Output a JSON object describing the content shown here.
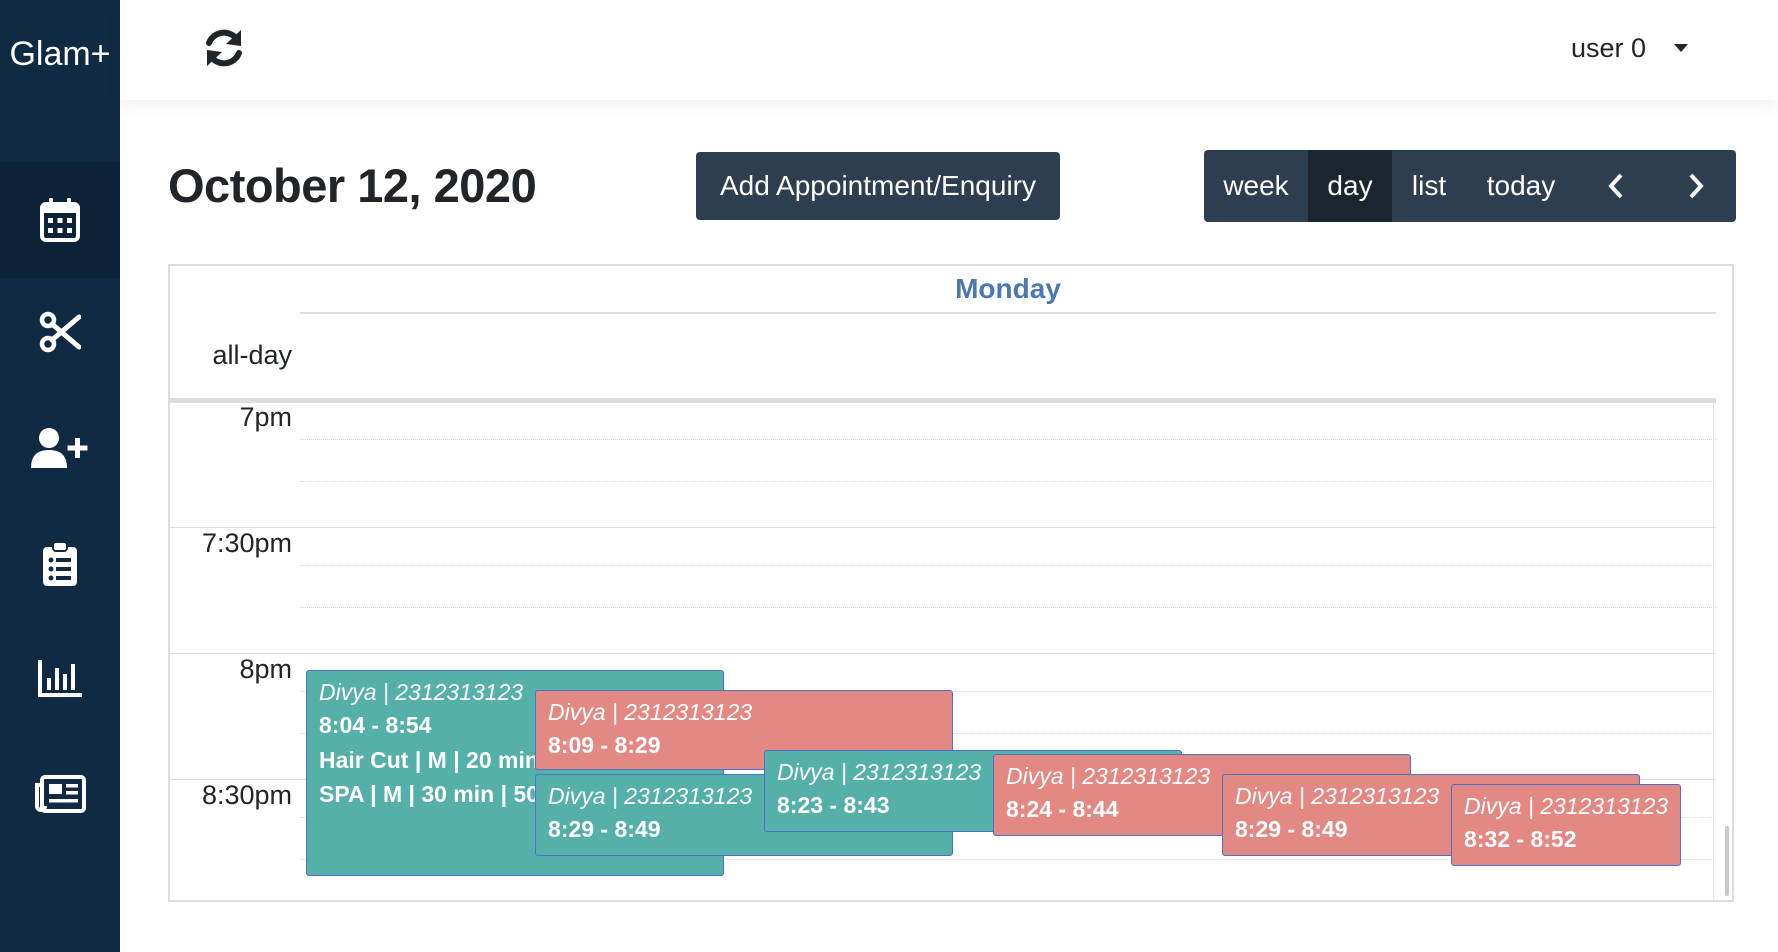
{
  "brand": "Glam+",
  "sidebar": {
    "items": [
      {
        "icon": "calendar-icon",
        "active": true
      },
      {
        "icon": "scissors-icon",
        "active": false
      },
      {
        "icon": "user-plus-icon",
        "active": false
      },
      {
        "icon": "clipboard-list-icon",
        "active": false
      },
      {
        "icon": "chart-bar-icon",
        "active": false
      },
      {
        "icon": "newspaper-icon",
        "active": false
      }
    ]
  },
  "topbar": {
    "refresh_icon": "sync-icon",
    "user": "user 0"
  },
  "header": {
    "date": "October 12, 2020",
    "add_button": "Add Appointment/Enquiry",
    "views": {
      "week": "week",
      "day": "day",
      "list": "list",
      "today": "today"
    },
    "active_view": "day"
  },
  "calendar": {
    "day_name": "Monday",
    "allday_label": "all-day",
    "times": {
      "t700": "7pm",
      "t730": "7:30pm",
      "t800": "8pm",
      "t830": "8:30pm"
    },
    "events": [
      {
        "client": "Divya | 2312313123",
        "time": "8:04 - 8:54",
        "services": [
          "Hair Cut | M | 20 min",
          "SPA | M | 30 min | 50"
        ],
        "color": "#54b0a8"
      },
      {
        "client": "Divya | 2312313123",
        "time": "8:09 - 8:29",
        "color": "#e48883"
      },
      {
        "client": "Divya | 2312313123",
        "time": "8:29 - 8:49",
        "color": "#54b0a8"
      },
      {
        "client": "Divya | 2312313123",
        "time": "8:23 - 8:43",
        "color": "#54b0a8"
      },
      {
        "client": "Divya | 2312313123",
        "time": "8:24 - 8:44",
        "color": "#e48883"
      },
      {
        "client": "Divya | 2312313123",
        "time": "8:29 - 8:49",
        "color": "#e48883"
      },
      {
        "client": "Divya | 2312313123",
        "time": "8:32 - 8:52",
        "color": "#e48883"
      }
    ]
  },
  "colors": {
    "sidebar": "#102a43",
    "button": "#2c3e50",
    "day_header": "#4a78b5",
    "event_green": "#54b0a8",
    "event_red": "#e48883"
  }
}
